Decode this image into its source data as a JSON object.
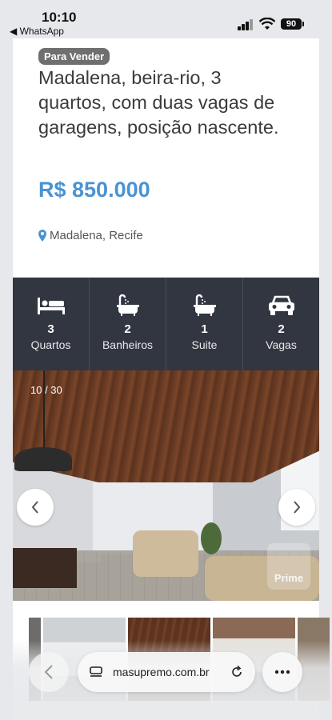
{
  "status_bar": {
    "time": "10:10",
    "back_app": "◀ WhatsApp",
    "battery": "90"
  },
  "listing": {
    "badge": "Para Vender",
    "title": "Madalena, beira-rio, 3 quartos, com duas vagas de garagens, posição nascente.",
    "price": "R$ 850.000",
    "location": "Madalena, Recife",
    "accent_color": "#4a93d1"
  },
  "features": [
    {
      "icon": "bed-icon",
      "count": "3",
      "label": "Quartos"
    },
    {
      "icon": "bathtub-icon",
      "count": "2",
      "label": "Banheiros"
    },
    {
      "icon": "bathtub-icon",
      "count": "1",
      "label": "Suite"
    },
    {
      "icon": "car-icon",
      "count": "2",
      "label": "Vagas"
    }
  ],
  "gallery": {
    "counter": "10 / 30",
    "watermark": "Prime"
  },
  "browser": {
    "url": "masupremo.com.br"
  }
}
